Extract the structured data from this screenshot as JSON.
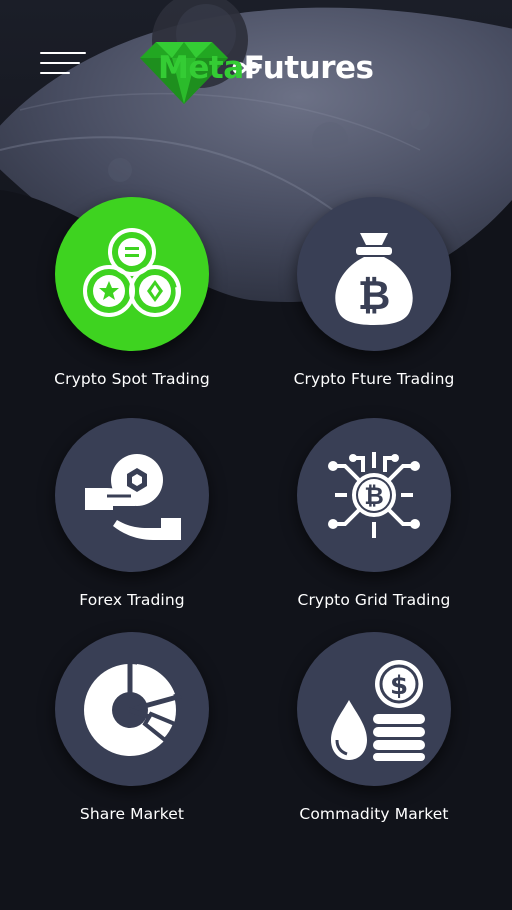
{
  "header": {
    "logo_part1": "Meta",
    "logo_part2": "Futures",
    "menu_icon": "hamburger-menu-icon"
  },
  "tiles": [
    {
      "label": "Crypto Spot Trading",
      "icon": "coins-icon",
      "active": true
    },
    {
      "label": "Crypto Fture Trading",
      "icon": "bitcoin-money-bag-icon",
      "active": false
    },
    {
      "label": "Forex Trading",
      "icon": "hand-coin-exchange-icon",
      "active": false
    },
    {
      "label": "Crypto Grid Trading",
      "icon": "bitcoin-circuit-icon",
      "active": false
    },
    {
      "label": "Share Market",
      "icon": "pie-chart-icon",
      "active": false
    },
    {
      "label": "Commadity Market",
      "icon": "oil-drop-coins-icon",
      "active": false
    }
  ],
  "colors": {
    "background": "#11131a",
    "tile": "#393f55",
    "accent": "#3ed320",
    "logo_green": "#34cc34"
  }
}
